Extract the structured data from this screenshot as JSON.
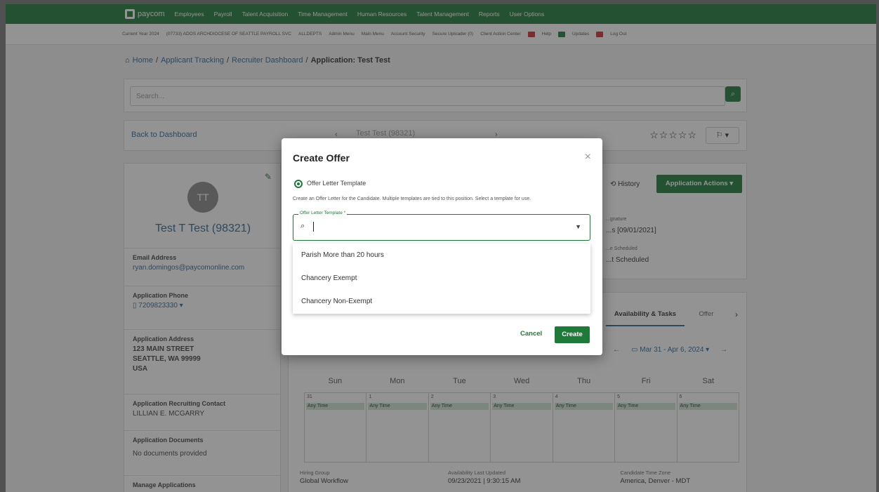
{
  "topbar": {
    "logo": "paycom",
    "nav": [
      "Employees",
      "Payroll",
      "Talent Acquisition",
      "Time Management",
      "Human Resources",
      "Talent Management",
      "Reports",
      "User Options"
    ]
  },
  "subbar": {
    "items": [
      "Current Year 2024",
      "(07733) ADOS ARCHDIOCESE OF SEATTLE PAYROLL SVC",
      "ALLDEPTS",
      "Admin Menu",
      "Main Menu",
      "Account Security",
      "Secure Uploader (0)",
      "Client Action Center",
      "Help",
      "Updates",
      "Log Out"
    ]
  },
  "breadcrumb": {
    "home": "Home",
    "items": [
      "Applicant Tracking",
      "Recruiter Dashboard"
    ],
    "current": "Application: Test Test"
  },
  "search": {
    "placeholder": "Search..."
  },
  "nav_card": {
    "back": "Back to Dashboard",
    "candidate_select": "Test Test (98321)",
    "stars": "☆☆☆☆☆"
  },
  "candidate": {
    "initials": "TT",
    "name": "Test T Test (98321)",
    "email_label": "Email Address",
    "email": "ryan.domingos@paycomonline.com",
    "phone_label": "Application Phone",
    "phone": "7209823330",
    "address_label": "Application Address",
    "address_line1": "123 MAIN STREET",
    "address_line2": "SEATTLE, WA 99999",
    "address_line3": "USA",
    "contact_label": "Application Recruiting Contact",
    "contact": "LILLIAN E. MCGARRY",
    "docs_label": "Application Documents",
    "docs": "No documents provided",
    "manage_label": "Manage Applications"
  },
  "right_top": {
    "history": "History",
    "actions": "Application Actions",
    "sig_label": "...gnature",
    "sig_value": "...s [09/01/2021]",
    "sched_label": "...e Scheduled",
    "sched_value": "...t Scheduled"
  },
  "right_bottom": {
    "tab_avail": "Availability & Tasks",
    "tab_offer": "Offer",
    "date_range": "Mar 31 - Apr 6, 2024",
    "days": [
      "Sun",
      "Mon",
      "Tue",
      "Wed",
      "Thu",
      "Fri",
      "Sat"
    ],
    "dates": [
      "31",
      "1",
      "2",
      "3",
      "4",
      "5",
      "6"
    ],
    "any_time": "Any Time",
    "hiring_group_label": "Hiring Group",
    "hiring_group": "Global Workflow",
    "avail_updated_label": "Availability Last Updated",
    "avail_updated": "09/23/2021 | 9:30:15 AM",
    "tz_label": "Candidate Time Zone",
    "tz": "America, Denver - MDT"
  },
  "modal": {
    "title": "Create Offer",
    "radio_label": "Offer Letter Template",
    "helper": "Create an Offer Letter for the Candidate. Multiple templates are tied to this position. Select a template for use.",
    "field_label": "Offer Letter Template *",
    "options": [
      "Parish More than 20 hours",
      "Chancery Exempt",
      "Chancery Non-Exempt"
    ],
    "cancel": "Cancel",
    "create": "Create"
  },
  "colors": {
    "brand": "#1f7a3a",
    "link": "#2f6a9a"
  }
}
